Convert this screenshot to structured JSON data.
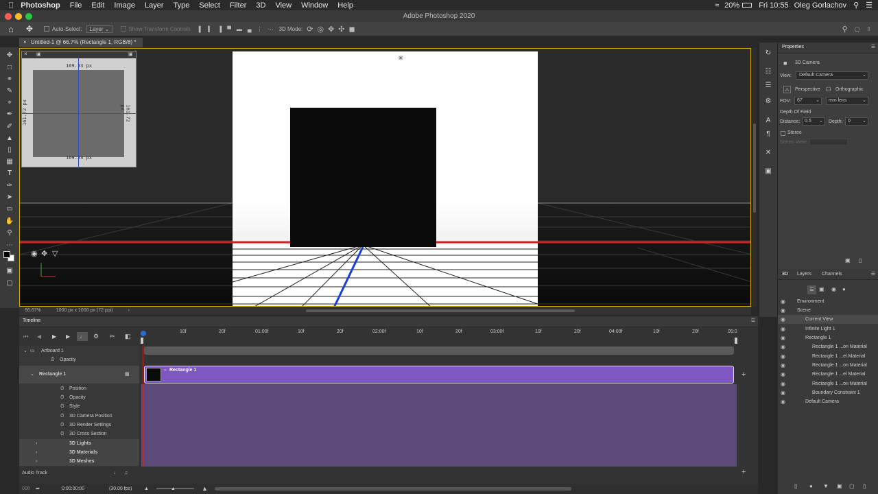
{
  "menubar": {
    "app": "Photoshop",
    "items": [
      "File",
      "Edit",
      "Image",
      "Layer",
      "Type",
      "Select",
      "Filter",
      "3D",
      "View",
      "Window",
      "Help"
    ],
    "battery": "20%",
    "clock": "Fri 10:55",
    "user": "Oleg Gorlachov"
  },
  "window_title": "Adobe Photoshop 2020",
  "options": {
    "auto_select": "Auto-Select:",
    "layer_select": "Layer",
    "show_transform": "Show Transform Controls",
    "mode_3d": "3D Mode:"
  },
  "document_tab": "Untitled-1 @ 66.7% (Rectangle 1, RGB/8) *",
  "navigator": {
    "top": "169.33 px",
    "bottom": "169.33 px",
    "left": "161.72 px",
    "right": "161.72 px"
  },
  "status": {
    "zoom": "66.67%",
    "doc_info": "1000 px x 1000 px (72 ppi)"
  },
  "properties": {
    "title": "Properties",
    "type": "3D Camera",
    "view_label": "View:",
    "view_value": "Default Camera",
    "perspective": "Perspective",
    "orthographic": "Orthographic",
    "fov_label": "FOV:",
    "fov_value": "67",
    "lens_value": "mm lens",
    "dof_label": "Depth Of Field",
    "distance_label": "Distance:",
    "distance_value": "0.5",
    "depth_label": "Depth:",
    "depth_value": "0",
    "stereo_label": "Stereo",
    "stereo_view_label": "Stereo View:"
  },
  "panel3d": {
    "tabs": [
      "3D",
      "Layers",
      "Channels"
    ],
    "tree": [
      {
        "label": "Environment",
        "indent": 0
      },
      {
        "label": "Scene",
        "indent": 0
      },
      {
        "label": "Current View",
        "indent": 1
      },
      {
        "label": "Infinite Light 1",
        "indent": 1
      },
      {
        "label": "Rectangle 1",
        "indent": 1
      },
      {
        "label": "Rectangle 1 ...on Material",
        "indent": 2
      },
      {
        "label": "Rectangle 1 ...el Material",
        "indent": 2
      },
      {
        "label": "Rectangle 1 ...on Material",
        "indent": 2
      },
      {
        "label": "Rectangle 1 ...el Material",
        "indent": 2
      },
      {
        "label": "Rectangle 1 ...on Material",
        "indent": 2
      },
      {
        "label": "Boundary Constraint 1",
        "indent": 2
      },
      {
        "label": "Default Camera",
        "indent": 1
      }
    ]
  },
  "timeline": {
    "title": "Timeline",
    "ruler": [
      "10f",
      "20f",
      "01:00f",
      "10f",
      "20f",
      "02:00f",
      "10f",
      "20f",
      "03:00f",
      "10f",
      "20f",
      "04:00f",
      "10f",
      "20f",
      "05:0"
    ],
    "layers": [
      {
        "label": "Artboard 1",
        "indent": 1
      },
      {
        "label": "Opacity",
        "indent": 3
      },
      {
        "label": "Rectangle 1",
        "indent": 2
      },
      {
        "label": "Position",
        "indent": 4
      },
      {
        "label": "Opacity",
        "indent": 4
      },
      {
        "label": "Style",
        "indent": 4
      },
      {
        "label": "3D Camera Position",
        "indent": 4
      },
      {
        "label": "3D Render Settings",
        "indent": 4
      },
      {
        "label": "3D Cross Section",
        "indent": 4
      },
      {
        "label": "3D Lights",
        "indent": 3
      },
      {
        "label": "3D Materials",
        "indent": 3
      },
      {
        "label": "3D Meshes",
        "indent": 3
      }
    ],
    "clip_label": "Rectangle 1",
    "audio_track": "Audio Track",
    "timecode": "0:00:00:00",
    "fps": "(30.00 fps)",
    "frame": "000"
  },
  "colors": {
    "clip_purple": "#7e57c2",
    "track_purple": "#5c4b78",
    "playhead": "#c03030",
    "accent_blue": "#2b6cd4"
  }
}
